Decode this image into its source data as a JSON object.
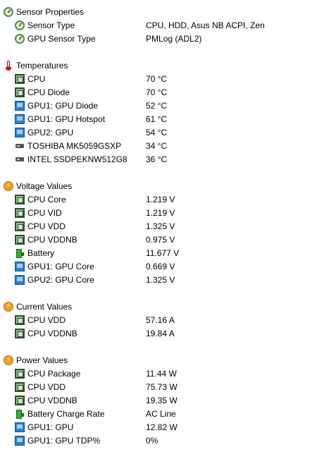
{
  "colors": {
    "background": "#ffffff",
    "text": "#000000"
  },
  "sections": {
    "sensor": {
      "label": "Sensor Properties",
      "icon": "sensor-gauge-icon",
      "items": [
        {
          "label": "Sensor Type",
          "value": "CPU, HDD, Asus NB ACPI, Zen",
          "icon": "sensor-gauge-icon"
        },
        {
          "label": "GPU Sensor Type",
          "value": "PMLog  (ADL2)",
          "icon": "sensor-gauge-icon"
        }
      ]
    },
    "temperatures": {
      "label": "Temperatures",
      "icon": "thermometer-icon",
      "items": [
        {
          "label": "CPU",
          "value": "70 °C",
          "icon": "cpu-chip-icon"
        },
        {
          "label": "CPU Diode",
          "value": "70 °C",
          "icon": "cpu-chip-icon"
        },
        {
          "label": "GPU1: GPU Diode",
          "value": "52 °C",
          "icon": "gpu-icon"
        },
        {
          "label": "GPU1: GPU Hotspot",
          "value": "61 °C",
          "icon": "gpu-icon"
        },
        {
          "label": "GPU2: GPU",
          "value": "54 °C",
          "icon": "gpu-icon"
        },
        {
          "label": "TOSHIBA MK5059GSXP",
          "value": "34 °C",
          "icon": "drive-icon"
        },
        {
          "label": "INTEL SSDPEKNW512G8",
          "value": "36 °C",
          "icon": "drive-icon"
        }
      ]
    },
    "voltage": {
      "label": "Voltage Values",
      "icon": "voltage-bolt-icon",
      "items": [
        {
          "label": "CPU Core",
          "value": "1.219 V",
          "icon": "cpu-chip-icon"
        },
        {
          "label": "CPU VID",
          "value": "1.219 V",
          "icon": "cpu-chip-icon"
        },
        {
          "label": "CPU VDD",
          "value": "1.325 V",
          "icon": "cpu-chip-icon"
        },
        {
          "label": "CPU VDDNB",
          "value": "0.975 V",
          "icon": "cpu-chip-icon"
        },
        {
          "label": "Battery",
          "value": "11.677 V",
          "icon": "battery-icon"
        },
        {
          "label": "GPU1: GPU Core",
          "value": "0.669 V",
          "icon": "gpu-icon"
        },
        {
          "label": "GPU2: GPU Core",
          "value": "1.325 V",
          "icon": "gpu-icon"
        }
      ]
    },
    "current": {
      "label": "Current Values",
      "icon": "current-bolt-icon",
      "items": [
        {
          "label": "CPU VDD",
          "value": "57.16 A",
          "icon": "cpu-chip-icon"
        },
        {
          "label": "CPU VDDNB",
          "value": "19.84 A",
          "icon": "cpu-chip-icon"
        }
      ]
    },
    "power": {
      "label": "Power Values",
      "icon": "power-bolt-icon",
      "items": [
        {
          "label": "CPU Package",
          "value": "11.44 W",
          "icon": "cpu-chip-icon"
        },
        {
          "label": "CPU VDD",
          "value": "75.73 W",
          "icon": "cpu-chip-icon"
        },
        {
          "label": "CPU VDDNB",
          "value": "19.35 W",
          "icon": "cpu-chip-icon"
        },
        {
          "label": "Battery Charge Rate",
          "value": "AC Line",
          "icon": "battery-icon"
        },
        {
          "label": "GPU1: GPU",
          "value": "12.82 W",
          "icon": "gpu-icon"
        },
        {
          "label": "GPU1: GPU TDP%",
          "value": "0%",
          "icon": "gpu-icon"
        }
      ]
    }
  }
}
